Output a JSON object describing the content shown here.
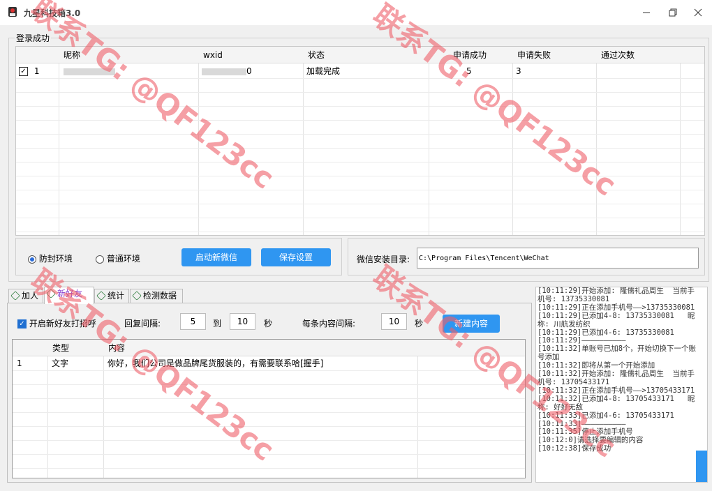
{
  "window": {
    "title": "九星科技箱3.0"
  },
  "login_group": {
    "legend": "登录成功",
    "columns": [
      "昵称",
      "wxid",
      "状态",
      "申请成功",
      "申请失败",
      "通过次数"
    ],
    "rows": [
      {
        "index": "1",
        "checked": true,
        "nickname": "",
        "wxid": "0",
        "status": "加载完成",
        "success": "5",
        "fail": "3",
        "passed": ""
      }
    ]
  },
  "env": {
    "radio_protected": "防封环境",
    "radio_normal": "普通环境",
    "selected": "防封环境",
    "launch_button": "启动新微信",
    "save_button": "保存设置"
  },
  "install": {
    "label": "微信安装目录:",
    "path": "C:\\Program Files\\Tencent\\WeChat"
  },
  "tabs": [
    "加人",
    "新好友",
    "统计",
    "检测数据"
  ],
  "active_tab": "新好友",
  "greeting": {
    "checkbox_label": "开启新好友打招呼",
    "checked": true,
    "reply_interval_label": "回复间隔:",
    "from": "5",
    "to_label": "到",
    "to": "10",
    "sec_label": "秒",
    "content_interval_label": "每条内容间隔:",
    "content_interval": "10",
    "sec_label2": "秒",
    "new_button": "新建内容"
  },
  "content_table": {
    "columns": [
      "类型",
      "内容"
    ],
    "rows": [
      {
        "index": "1",
        "type": "文字",
        "content": "你好，我们公司是做品牌尾货服装的，有需要联系哈[握手]"
      }
    ]
  },
  "log": [
    "[10:11:29]开始添加: 隆儒礼品周生  当前手机号: 13735330081",
    "[10:11:29]正在添加手机号——>13735330081",
    "[10:11:29]已添加4-8: 13735330081   昵称: 川航发纺织",
    "[10:11:29]已添加4-6: 13735330081",
    "[10:11:29]——————————",
    "[10:11:32]单账号已加8个，开始切换下一个账号添加",
    "[10:11:32]即将从第一个开始添加",
    "[10:11:32]开始添加: 隆儒礼品周生  当前手机号: 13705433171",
    "[10:11:32]正在添加手机号——>13705433171",
    "[10:11:32]已添加4-8: 13705433171   昵称: 好好无敌",
    "[10:11:33]已添加4-6: 13705433171",
    "[10:11:33]——————————",
    "[10:11:35]停止添加手机号",
    "[10:12:0]请选择要编辑的内容",
    "[10:12:38]保存成功"
  ],
  "watermark": "联系TG: @QF123cc",
  "colors": {
    "accent": "#2f96f1",
    "watermark": "#ee5f69"
  }
}
